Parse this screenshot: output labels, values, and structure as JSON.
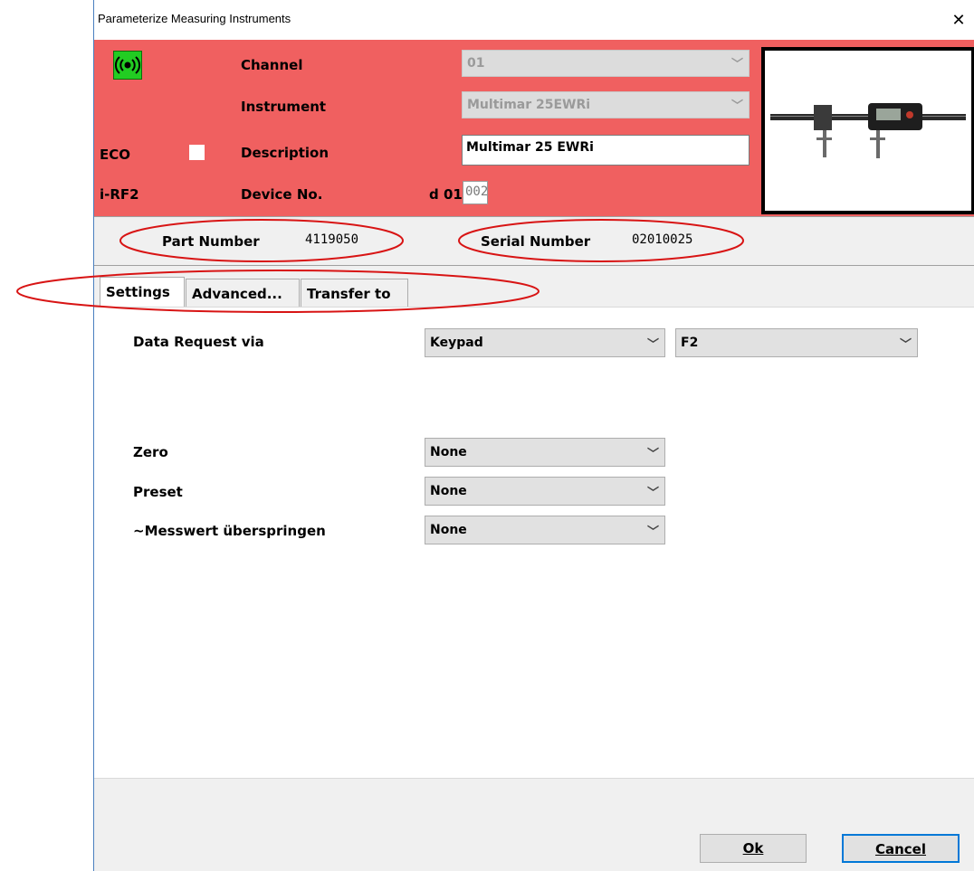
{
  "window": {
    "title": "Parameterize Measuring Instruments",
    "close_glyph": "✕"
  },
  "header": {
    "status_icon": "wireless-signal-icon",
    "eco_label": "ECO",
    "eco_checked": false,
    "irf_label": "i-RF2",
    "channel_label": "Channel",
    "channel_value": "01",
    "instrument_label": "Instrument",
    "instrument_value": "Multimar 25EWRi",
    "description_label": "Description",
    "description_value": "Multimar 25 EWRi",
    "device_no_label": "Device No.",
    "device_prefix": "d 01",
    "device_no_value": "002",
    "instrument_image": "digital-caliper-image"
  },
  "info": {
    "part_number_label": "Part Number",
    "part_number_value": "4119050",
    "serial_number_label": "Serial Number",
    "serial_number_value": "02010025"
  },
  "tabs": [
    {
      "label": "Settings",
      "active": true
    },
    {
      "label": "Advanced...",
      "active": false
    },
    {
      "label": "Transfer to",
      "active": false
    }
  ],
  "settings": {
    "data_request_label": "Data Request via",
    "data_request_value": "Keypad",
    "data_request_key": "F2",
    "zero_label": "Zero",
    "zero_value": "None",
    "preset_label": "Preset",
    "preset_value": "None",
    "skip_label": "~Messwert überspringen",
    "skip_value": "None"
  },
  "buttons": {
    "ok_label": "Ok",
    "cancel_label": "Cancel"
  },
  "colors": {
    "header_bg": "#f06060",
    "annotation": "#d81414",
    "status_icon_bg": "#22cc22",
    "default_button_border": "#0078d7"
  }
}
